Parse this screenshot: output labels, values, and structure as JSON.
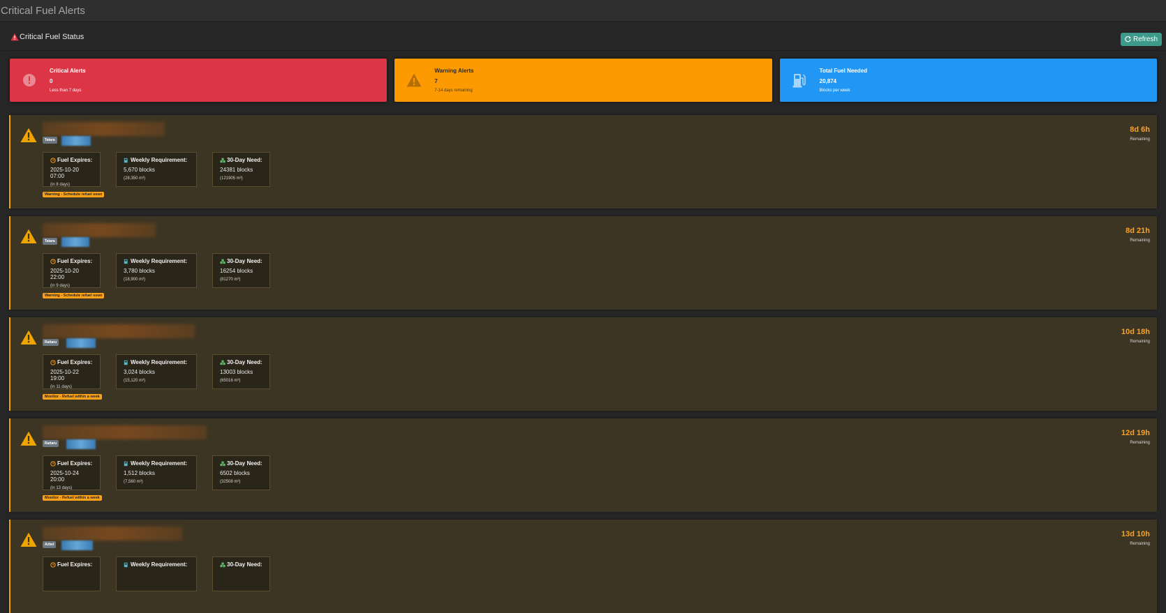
{
  "page": {
    "title": "Critical Fuel Alerts"
  },
  "panel": {
    "title": "Critical Fuel Status",
    "refresh_label": "Refresh"
  },
  "stats": [
    {
      "label": "Critical Alerts",
      "value": "0",
      "sub": "Less than 7 days",
      "color": "#dc3545",
      "icon": "exclamation-circle-icon"
    },
    {
      "label": "Warning Alerts",
      "value": "7",
      "sub": "7-14 days remaining",
      "color": "#fd9a02",
      "icon": "warning-triangle-icon"
    },
    {
      "label": "Total Fuel Needed",
      "value": "20,874",
      "sub": "Blocks per week",
      "color": "#2196f3",
      "icon": "gas-pump-icon"
    }
  ],
  "labels": {
    "fuel_expires": "Fuel Expires:",
    "weekly_requirement": "Weekly Requirement:",
    "thirty_day_need": "30-Day Need:",
    "remaining": "Remaining"
  },
  "alerts": [
    {
      "type": "Tatara",
      "expires": "2025-10-20 07:00",
      "in_days": "(in 8 days)",
      "weekly_blocks": "5,670 blocks",
      "weekly_m3": "(28,350 m³)",
      "month_blocks": "24381 blocks",
      "month_m3": "(121905 m³)",
      "status": "Warning - Schedule refuel soon",
      "time": "8d 6h"
    },
    {
      "type": "Tatara",
      "expires": "2025-10-20 22:00",
      "in_days": "(in 9 days)",
      "weekly_blocks": "3,780 blocks",
      "weekly_m3": "(18,900 m³)",
      "month_blocks": "16254 blocks",
      "month_m3": "(81270 m³)",
      "status": "Warning - Schedule refuel soon",
      "time": "8d 21h"
    },
    {
      "type": "Raitaru",
      "expires": "2025-10-22 19:00",
      "in_days": "(in 11 days)",
      "weekly_blocks": "3,024 blocks",
      "weekly_m3": "(15,120 m³)",
      "month_blocks": "13003 blocks",
      "month_m3": "(65016 m³)",
      "status": "Monitor - Refuel within a week",
      "time": "10d 18h"
    },
    {
      "type": "Raitaru",
      "expires": "2025-10-24 20:00",
      "in_days": "(in 13 days)",
      "weekly_blocks": "1,512 blocks",
      "weekly_m3": "(7,560 m³)",
      "month_blocks": "6502 blocks",
      "month_m3": "(32508 m³)",
      "status": "Monitor - Refuel within a week",
      "time": "12d 19h"
    },
    {
      "type": "Azbel",
      "time": "13d 10h"
    }
  ],
  "colors": {
    "critical": "#dc3545",
    "warning": "#fd9a02",
    "info": "#2196f3",
    "accent_time": "#ffa21a",
    "refresh_button": "#3e9a8a"
  }
}
